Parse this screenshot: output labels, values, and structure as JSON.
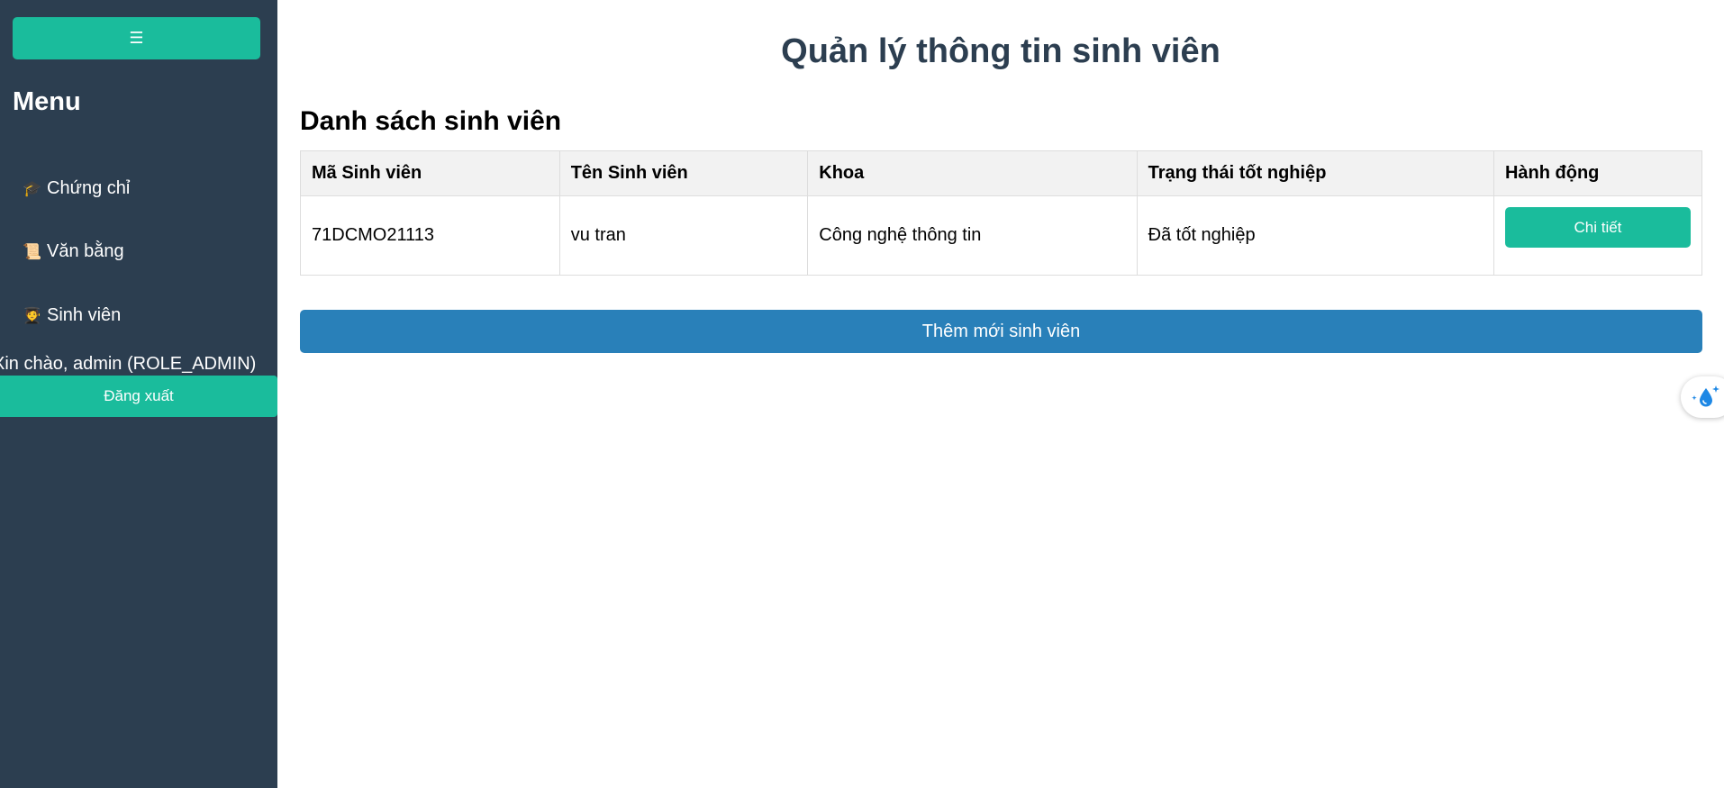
{
  "sidebar": {
    "toggle_label": "☰",
    "menu_title": "Menu",
    "items": [
      {
        "icon": "graduation-cap-icon",
        "glyph": "🎓",
        "label": "Chứng chỉ"
      },
      {
        "icon": "scroll-icon",
        "glyph": "📜",
        "label": "Văn bằng"
      },
      {
        "icon": "student-icon",
        "glyph": "🧑‍🎓",
        "label": "Sinh viên"
      }
    ],
    "greeting": "Xin chào, admin (ROLE_ADMIN)",
    "logout_label": "Đăng xuất"
  },
  "main": {
    "page_title": "Quản lý thông tin sinh viên",
    "section_title": "Danh sách sinh viên",
    "table": {
      "headers": [
        "Mã Sinh viên",
        "Tên Sinh viên",
        "Khoa",
        "Trạng thái tốt nghiệp",
        "Hành động"
      ],
      "rows": [
        {
          "student_id": "71DCMO21113",
          "name": "vu tran",
          "faculty": "Công nghệ thông tin",
          "status": "Đã tốt nghiệp",
          "action_label": "Chi tiết"
        }
      ]
    },
    "add_button_label": "Thêm mới sinh viên"
  },
  "floating_widget": {
    "icon": "water-drop-sparkle-icon"
  },
  "colors": {
    "sidebar_bg": "#2c3e50",
    "accent_green": "#1abc9c",
    "primary_blue": "#2980b9",
    "title_color": "#2c3e50"
  }
}
